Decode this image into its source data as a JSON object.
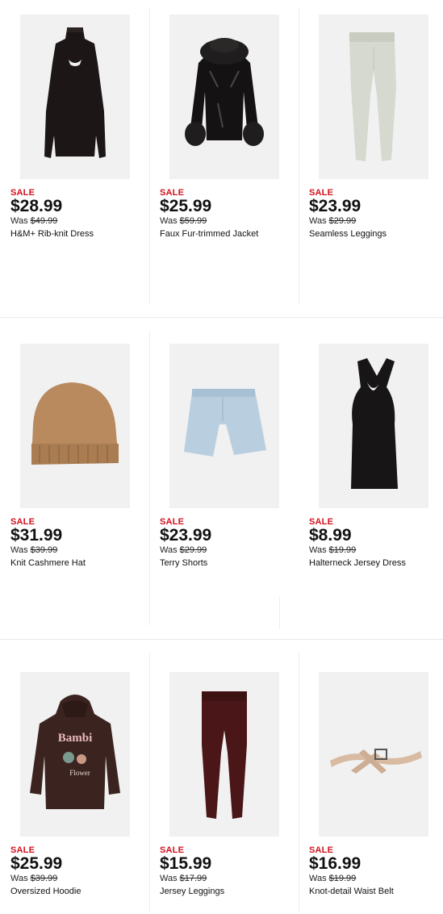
{
  "products": [
    {
      "name": "H&M+ Rib-knit Dress",
      "sale_label": "SALE",
      "price": "$28.99",
      "was_label": "Was",
      "was_price": "$49.99",
      "image": "black-rib-knit-dress"
    },
    {
      "name": "Faux Fur-trimmed Jacket",
      "sale_label": "SALE",
      "price": "$25.99",
      "was_label": "Was",
      "was_price": "$59.99",
      "image": "black-faux-fur-jacket"
    },
    {
      "name": "Seamless Leggings",
      "sale_label": "SALE",
      "price": "$23.99",
      "was_label": "Was",
      "was_price": "$29.99",
      "image": "sage-seamless-leggings"
    },
    {
      "name": "Knit Cashmere Hat",
      "sale_label": "SALE",
      "price": "$31.99",
      "was_label": "Was",
      "was_price": "$39.99",
      "image": "camel-knit-hat"
    },
    {
      "name": "Terry Shorts",
      "sale_label": "SALE",
      "price": "$23.99",
      "was_label": "Was",
      "was_price": "$29.99",
      "image": "light-blue-terry-shorts"
    },
    {
      "name": "Halterneck Jersey Dress",
      "sale_label": "SALE",
      "price": "$8.99",
      "was_label": "Was",
      "was_price": "$19.99",
      "image": "black-halterneck-dress"
    },
    {
      "name": "Oversized Hoodie",
      "sale_label": "SALE",
      "price": "$25.99",
      "was_label": "Was",
      "was_price": "$39.99",
      "image": "brown-bambi-hoodie"
    },
    {
      "name": "Jersey Leggings",
      "sale_label": "SALE",
      "price": "$15.99",
      "was_label": "Was",
      "was_price": "$17.99",
      "image": "burgundy-jersey-leggings"
    },
    {
      "name": "Knot-detail Waist Belt",
      "sale_label": "SALE",
      "price": "$16.99",
      "was_label": "Was",
      "was_price": "$19.99",
      "image": "beige-knot-belt"
    }
  ],
  "hoodie_print": {
    "line1": "Bambi",
    "line2": "Flower"
  },
  "colors": {
    "sale": "#d1111d",
    "thumb_bg": "#f1f1f1"
  }
}
